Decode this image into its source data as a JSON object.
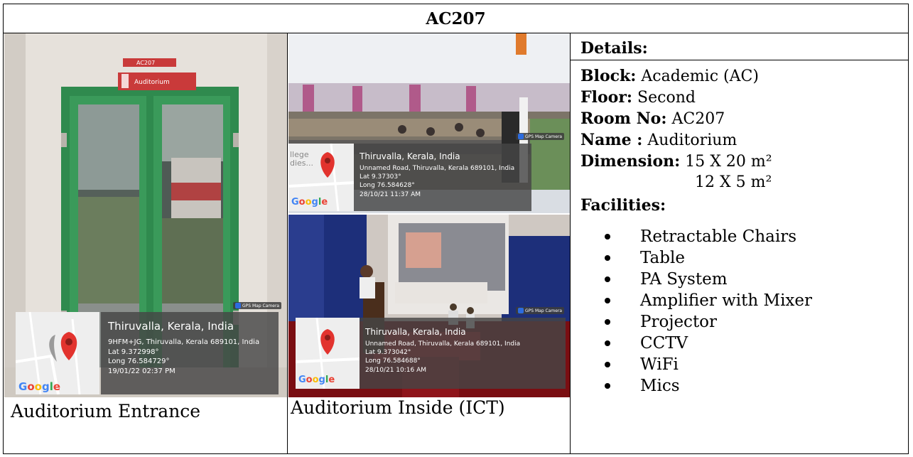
{
  "title": "AC207",
  "left_photo": {
    "sign_code": "AC207",
    "sign_name": "Auditorium",
    "overlay": {
      "place": "Thiruvalla, Kerala, India",
      "address": "9HFM+JG, Thiruvalla, Kerala 689101, India",
      "lat": "Lat 9.372998°",
      "long": "Long 76.584729°",
      "datetime": "19/01/22 02:37 PM",
      "map_logo": "Google",
      "tag": "GPS Map Camera"
    },
    "caption": "Auditorium Entrance"
  },
  "mid_top_photo": {
    "overlay": {
      "map_label": "llege\ndies...",
      "place": "Thiruvalla, Kerala, India",
      "address": "Unnamed Road, Thiruvalla, Kerala 689101, India",
      "lat": "Lat 9.37303°",
      "long": "Long 76.584628°",
      "datetime": "28/10/21 11:37 AM",
      "map_logo": "Google",
      "tag": "GPS Map Camera"
    }
  },
  "mid_bottom_photo": {
    "overlay": {
      "place": "Thiruvalla, Kerala, India",
      "address": "Unnamed Road, Thiruvalla, Kerala 689101, India",
      "lat": "Lat 9.373042°",
      "long": "Long 76.584688°",
      "datetime": "28/10/21 10:16 AM",
      "map_logo": "Google",
      "tag": "GPS Map Camera"
    },
    "caption": "Auditorium Inside (ICT)"
  },
  "details": {
    "heading": "Details:",
    "block_label": "Block:",
    "block_value": " Academic (AC)",
    "floor_label": "Floor:",
    "floor_value": " Second",
    "room_label": "Room No:",
    "room_value": " AC207",
    "name_label": "Name :",
    "name_value": " Auditorium",
    "dimension_label": "Dimension:",
    "dimension_value_1": " 15 X 20 m²",
    "dimension_value_2": "12 X 5 m²",
    "facilities_label": "Facilities:",
    "facilities": [
      "Retractable Chairs",
      "Table",
      "PA System",
      "Amplifier with Mixer",
      "Projector",
      "CCTV",
      "WiFi",
      "Mics"
    ]
  }
}
